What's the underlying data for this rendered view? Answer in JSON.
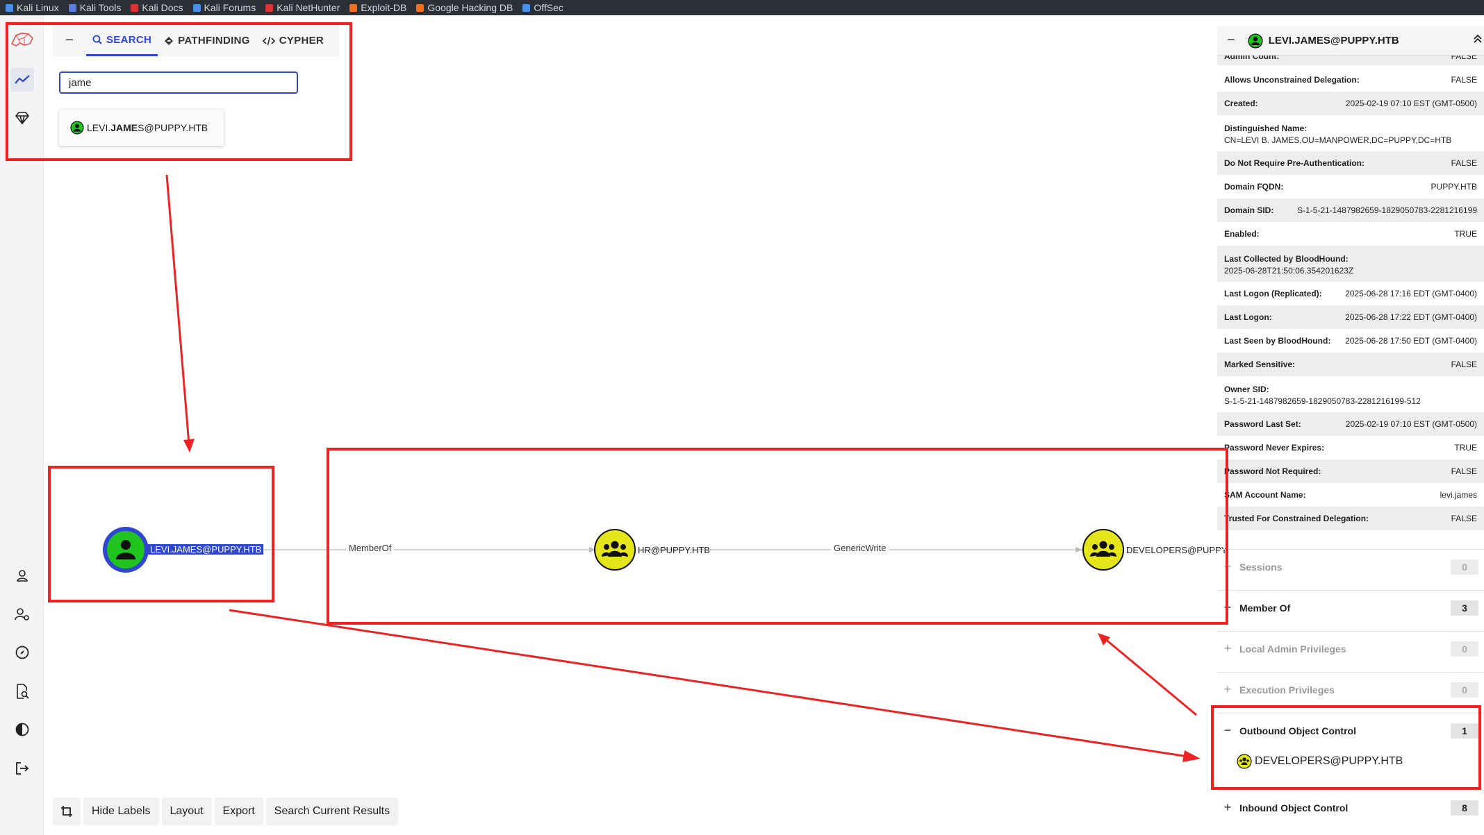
{
  "bookmarks": [
    {
      "label": "Kali Linux",
      "color": "#4a8fe7"
    },
    {
      "label": "Kali Tools",
      "color": "#5a7fe0"
    },
    {
      "label": "Kali Docs",
      "color": "#d33"
    },
    {
      "label": "Kali Forums",
      "color": "#4a8fe7"
    },
    {
      "label": "Kali NetHunter",
      "color": "#d33"
    },
    {
      "label": "Exploit-DB",
      "color": "#f07020"
    },
    {
      "label": "Google Hacking DB",
      "color": "#f07020"
    },
    {
      "label": "OffSec",
      "color": "#4a8fe7"
    }
  ],
  "search": {
    "tabs": [
      "SEARCH",
      "PATHFINDING",
      "CYPHER"
    ],
    "query": "jame",
    "suggestion": {
      "before": "LEVI.",
      "match": "JAME",
      "after": "S@PUPPY.HTB"
    }
  },
  "graph": {
    "nodes": {
      "user": "LEVI.JAMES@PUPPY.HTB",
      "hr": "HR@PUPPY.HTB",
      "dev": "DEVELOPERS@PUPPY"
    },
    "edges": {
      "e1": "MemberOf",
      "e2": "GenericWrite"
    }
  },
  "toolbar": {
    "hide_labels": "Hide Labels",
    "layout": "Layout",
    "export": "Export",
    "search_results": "Search Current Results"
  },
  "panel": {
    "title": "LEVI.JAMES@PUPPY.HTB",
    "clipped": {
      "name": "Admin Count:",
      "value": "FALSE"
    },
    "props": [
      {
        "name": "Allows Unconstrained Delegation:",
        "value": "FALSE"
      },
      {
        "name": "Created:",
        "value": "2025-02-19 07:10 EST (GMT-0500)"
      },
      {
        "name": "Distinguished Name:",
        "value": "CN=LEVI B. JAMES,OU=MANPOWER,DC=PUPPY,DC=HTB"
      },
      {
        "name": "Do Not Require Pre-Authentication:",
        "value": "FALSE"
      },
      {
        "name": "Domain FQDN:",
        "value": "PUPPY.HTB"
      },
      {
        "name": "Domain SID:",
        "value": "S-1-5-21-1487982659-1829050783-2281216199"
      },
      {
        "name": "Enabled:",
        "value": "TRUE"
      },
      {
        "name": "Last Collected by BloodHound:",
        "value": "2025-06-28T21:50:06.354201623Z"
      },
      {
        "name": "Last Logon (Replicated):",
        "value": "2025-06-28 17:16 EDT (GMT-0400)"
      },
      {
        "name": "Last Logon:",
        "value": "2025-06-28 17:22 EDT (GMT-0400)"
      },
      {
        "name": "Last Seen by BloodHound:",
        "value": "2025-06-28 17:50 EDT (GMT-0400)"
      },
      {
        "name": "Marked Sensitive:",
        "value": "FALSE"
      },
      {
        "name": "Owner SID:",
        "value": "S-1-5-21-1487982659-1829050783-2281216199-512"
      },
      {
        "name": "Password Last Set:",
        "value": "2025-02-19 07:10 EST (GMT-0500)"
      },
      {
        "name": "Password Never Expires:",
        "value": "TRUE"
      },
      {
        "name": "Password Not Required:",
        "value": "FALSE"
      },
      {
        "name": "SAM Account Name:",
        "value": "levi.james"
      },
      {
        "name": "Trusted For Constrained Delegation:",
        "value": "FALSE"
      }
    ],
    "sections": [
      {
        "sign": "+",
        "label": "Sessions",
        "count": "0"
      },
      {
        "sign": "+",
        "label": "Member Of",
        "count": "3"
      },
      {
        "sign": "+",
        "label": "Local Admin Privileges",
        "count": "0"
      },
      {
        "sign": "+",
        "label": "Execution Privileges",
        "count": "0"
      },
      {
        "sign": "−",
        "label": "Outbound Object Control",
        "count": "1"
      },
      {
        "sign": "+",
        "label": "Inbound Object Control",
        "count": "8"
      }
    ],
    "outbound_item": "DEVELOPERS@PUPPY.HTB"
  },
  "colors": {
    "accent": "#2f46d1",
    "user_node": "#1fc41f",
    "group_node": "#e4e619",
    "annotation": "#ee2222"
  }
}
